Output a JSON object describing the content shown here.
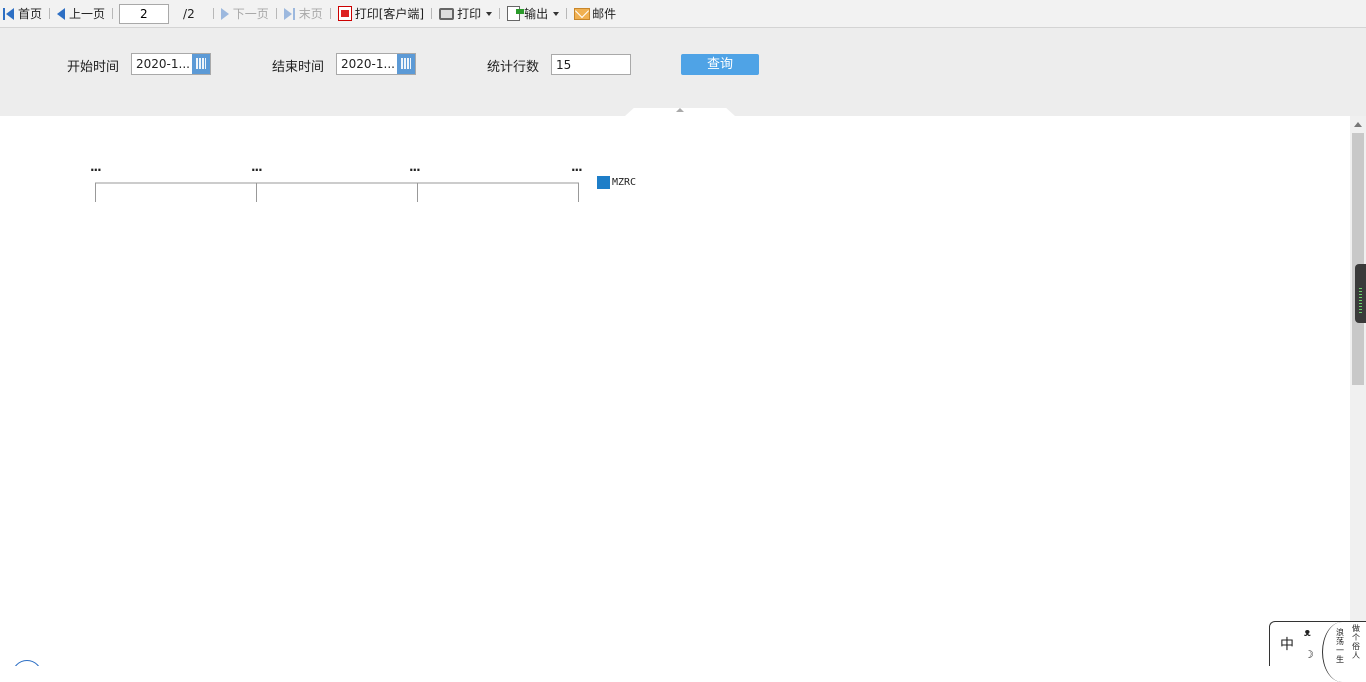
{
  "toolbar": {
    "first": "首页",
    "prev": "上一页",
    "page_current": "2",
    "page_total": "/2",
    "next": "下一页",
    "last": "末页",
    "print_client": "打印[客户端]",
    "print": "打印",
    "export": "输出",
    "mail": "邮件"
  },
  "params": {
    "start_label": "开始时间",
    "start_value": "2020-1...",
    "end_label": "结束时间",
    "end_value": "2020-1...",
    "rows_label": "统计行数",
    "rows_value": "15",
    "query_label": "查询"
  },
  "chart_data": {
    "type": "bar",
    "title": "",
    "categories": [],
    "x_tick_labels": [
      "...",
      "...",
      "...",
      "..."
    ],
    "series": [
      {
        "name": "MZRC",
        "values": [],
        "color": "#1e7ec8"
      }
    ],
    "legend_position": "right"
  },
  "ime": {
    "mode": "中",
    "vertical_1": "浪荡一生",
    "vertical_2": "做个俗人"
  }
}
